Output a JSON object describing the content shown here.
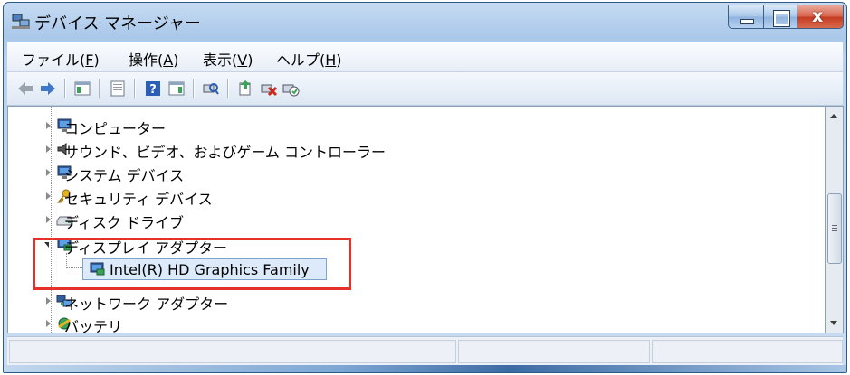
{
  "window": {
    "title": "デバイス マネージャー",
    "icon": "device-manager-icon",
    "controls": [
      "minimize",
      "maximize",
      "close"
    ],
    "close_glyph": "x"
  },
  "menu": [
    {
      "label_pre": "ファイル(",
      "key": "F",
      "label_post": ")"
    },
    {
      "label_pre": "操作(",
      "key": "A",
      "label_post": ")"
    },
    {
      "label_pre": "表示(",
      "key": "V",
      "label_post": ")"
    },
    {
      "label_pre": "ヘルプ(",
      "key": "H",
      "label_post": ")"
    }
  ],
  "toolbar": [
    "back-arrow-icon",
    "forward-arrow-icon",
    "show-hide-console-tree-icon",
    "properties-icon",
    "help-icon",
    "show-action-pane-icon",
    "scan-hardware-changes-icon",
    "update-driver-icon",
    "uninstall-icon",
    "disable-device-icon"
  ],
  "tree": {
    "items": [
      {
        "label": "コンピューター",
        "icon": "computer-icon",
        "expanded": false
      },
      {
        "label": "サウンド、ビデオ、およびゲーム コントローラー",
        "icon": "speaker-icon",
        "expanded": false
      },
      {
        "label": "システム デバイス",
        "icon": "system-device-icon",
        "expanded": false
      },
      {
        "label": "セキュリティ デバイス",
        "icon": "security-key-icon",
        "expanded": false
      },
      {
        "label": "ディスク ドライブ",
        "icon": "disk-drive-icon",
        "expanded": false
      },
      {
        "label": "ディスプレイ アダプター",
        "icon": "display-adapter-icon",
        "expanded": true
      },
      {
        "label": "ネットワーク アダプター",
        "icon": "network-adapter-icon",
        "expanded": false
      },
      {
        "label": "バッテリ",
        "icon": "battery-icon",
        "expanded": false
      }
    ],
    "selected_child": {
      "label": "Intel(R) HD Graphics Family",
      "icon": "display-adapter-icon"
    }
  },
  "colors": {
    "highlight": "#e4312a",
    "selection": "#dceafa"
  }
}
